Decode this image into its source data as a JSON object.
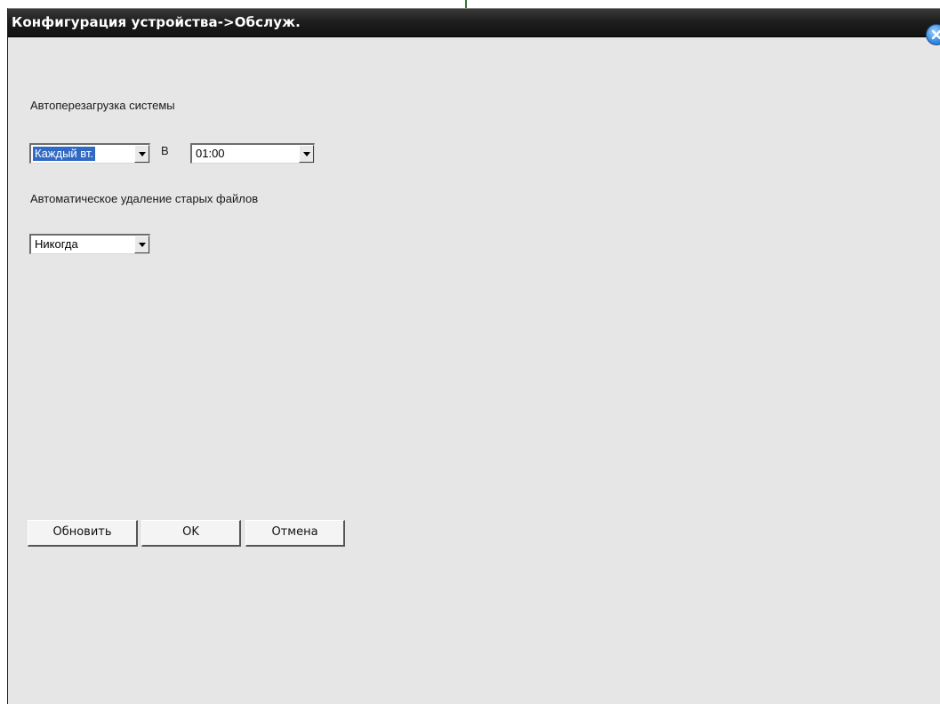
{
  "window": {
    "title": "Конфигурация устройства->Обслуж."
  },
  "auto_reboot": {
    "label": "Автоперезагрузка системы",
    "day_value": "Каждый вт.",
    "at_label": "В",
    "time_value": "01:00"
  },
  "auto_delete": {
    "label": "Автоматическое удаление старых файлов",
    "value": "Никогда"
  },
  "buttons": {
    "refresh": "Обновить",
    "ok": "OK",
    "cancel": "Отмена"
  },
  "icons": {
    "close": "close-icon",
    "dropdown": "chevron-down-icon"
  },
  "colors": {
    "titlebar": "#1e1e1e",
    "background": "#e6e6e6",
    "selection": "#316ac5",
    "close_button": "#3d8ee0"
  }
}
